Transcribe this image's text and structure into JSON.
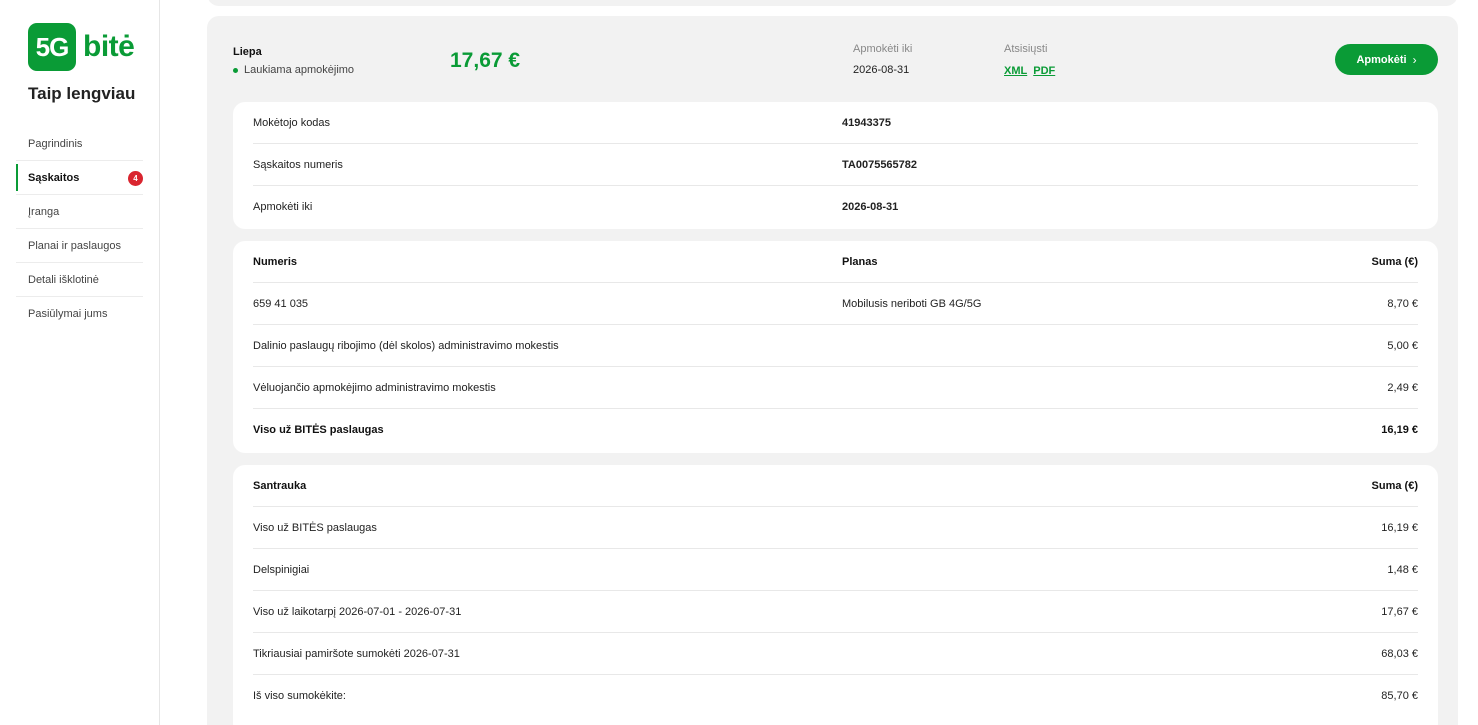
{
  "sidebar": {
    "logo_box": "5G",
    "logo_word": "bitė",
    "tagline": "Taip lengviau",
    "items": [
      {
        "label": "Pagrindinis"
      },
      {
        "label": "Sąskaitos",
        "badge": "4"
      },
      {
        "label": "Įranga"
      },
      {
        "label": "Planai ir paslaugos"
      },
      {
        "label": "Detali išklotinė"
      },
      {
        "label": "Pasiūlymai jums"
      }
    ]
  },
  "colors": {
    "brand": "#0a9b36",
    "badge": "#d9252f",
    "panel": "#f2f2f2"
  },
  "invoice": {
    "month": "Liepa",
    "status": "Laukiama apmokėjimo",
    "amount": "17,67 €",
    "due_label": "Apmokėti iki",
    "due_date": "2026-08-31",
    "download_label": "Atsisiųsti",
    "xml": "XML",
    "pdf": "PDF",
    "pay_button": "Apmokėti",
    "pay_chevron": "›"
  },
  "info": [
    {
      "label": "Mokėtojo kodas",
      "value": "41943375"
    },
    {
      "label": "Sąskaitos numeris",
      "value": "TA0075565782"
    },
    {
      "label": "Apmokėti iki",
      "value": "2026-08-31"
    }
  ],
  "lines": {
    "headers": {
      "number": "Numeris",
      "plan": "Planas",
      "sum": "Suma (€)"
    },
    "rows": [
      {
        "number": "659 41 035",
        "plan": "Mobilusis neriboti GB 4G/5G",
        "sum": "8,70 €"
      },
      {
        "number": "Dalinio paslaugų ribojimo (dėl skolos) administravimo mokestis",
        "plan": "",
        "sum": "5,00 €"
      },
      {
        "number": "Vėluojančio apmokėjimo administravimo mokestis",
        "plan": "",
        "sum": "2,49 €"
      }
    ],
    "total": {
      "label": "Viso už BITĖS paslaugas",
      "sum": "16,19 €"
    }
  },
  "summary": {
    "headers": {
      "label": "Santrauka",
      "sum": "Suma (€)"
    },
    "rows": [
      {
        "label": "Viso už BITĖS paslaugas",
        "sum": "16,19 €"
      },
      {
        "label": "Delspinigiai",
        "sum": "1,48 €"
      },
      {
        "label": "Viso už laikotarpį 2026-07-01 - 2026-07-31",
        "sum": "17,67 €"
      },
      {
        "label": "Tikriausiai pamiršote sumokėti 2026-07-31",
        "sum": "68,03 €"
      },
      {
        "label": "Iš viso sumokėkite:",
        "sum": "85,70 €"
      }
    ]
  }
}
